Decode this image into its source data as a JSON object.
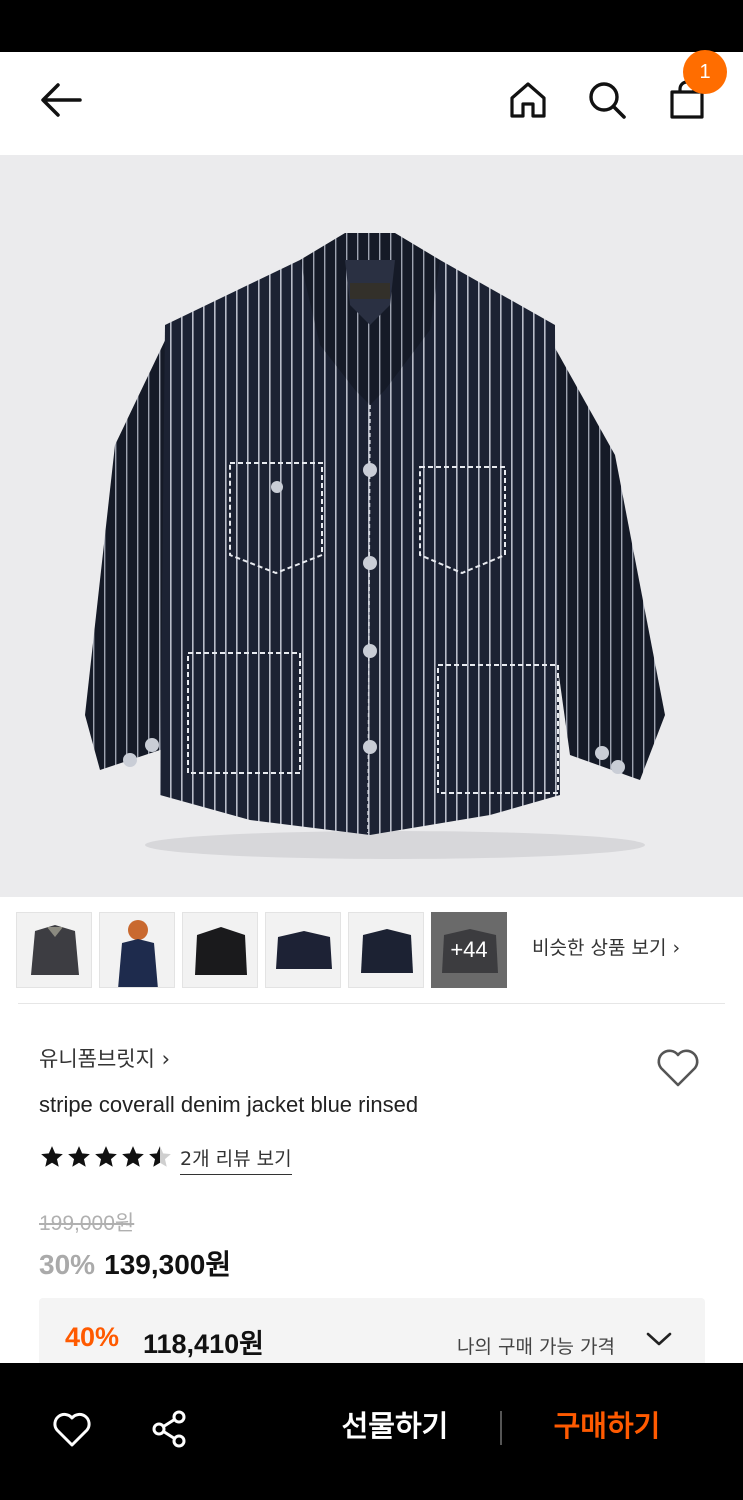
{
  "header": {
    "back_icon": "arrow-left-icon",
    "home_icon": "home-icon",
    "search_icon": "search-icon",
    "cart_icon": "shopping-bag-icon",
    "cart_count": "1"
  },
  "gallery": {
    "thumbnail_count": 6,
    "more_label": "+44",
    "similar_link": "비슷한 상품 보기 ›"
  },
  "product": {
    "brand": "유니폼브릿지 ›",
    "title": "stripe coverall denim jacket blue rinsed",
    "rating": 4.5,
    "review_link": "2개 리뷰 보기",
    "original_price": "199,000원",
    "discount_rate": "30%",
    "sale_price": "139,300원",
    "member_rate": "40%",
    "member_price": "118,410원",
    "member_label": "나의 구매 가능 가격"
  },
  "bottom_bar": {
    "gift_label": "선물하기",
    "buy_label": "구매하기"
  },
  "colors": {
    "accent": "#ff5a00",
    "badge": "#ff6d00",
    "jacket": "#1c2233"
  }
}
